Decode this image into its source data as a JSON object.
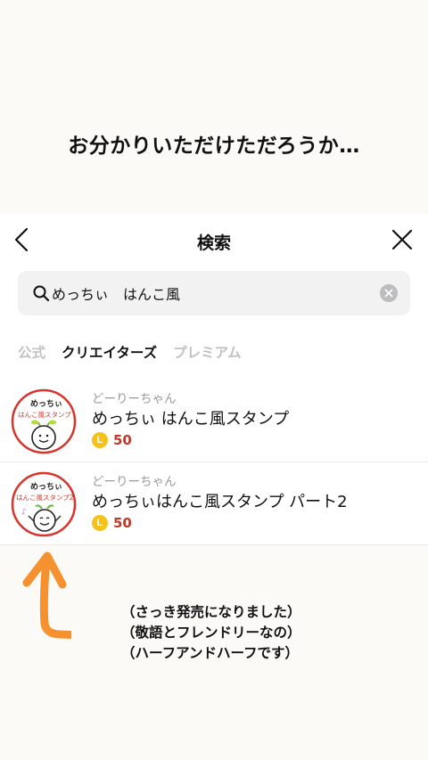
{
  "caption": "お分かりいただけただろうか…",
  "header": {
    "title": "検索"
  },
  "search": {
    "value": "めっちぃ　はんこ風"
  },
  "tabs": [
    {
      "label": "公式",
      "active": false
    },
    {
      "label": "クリエイターズ",
      "active": true
    },
    {
      "label": "プレミアム",
      "active": false
    }
  ],
  "results": [
    {
      "creator": "どーりーちゃん",
      "name": "めっちぃ はんこ風スタンプ",
      "coin": "L",
      "price": "50",
      "thumb_text": [
        "めっちぃ",
        "はんこ風スタンプ"
      ]
    },
    {
      "creator": "どーりーちゃん",
      "name": "めっちぃはんこ風スタンプ パート2",
      "coin": "L",
      "price": "50",
      "thumb_text": [
        "めっちぃ",
        "はんこ風スタンプ2"
      ]
    }
  ],
  "notes": [
    "（さっき発売になりました）",
    "（敬語とフレンドリーなの）",
    "（ハーフアンドハーフです）"
  ],
  "colors": {
    "price": "#c0392b",
    "coin": "#f4c31b",
    "arrow": "#f5922f",
    "stamp_red": "#d9342b"
  }
}
